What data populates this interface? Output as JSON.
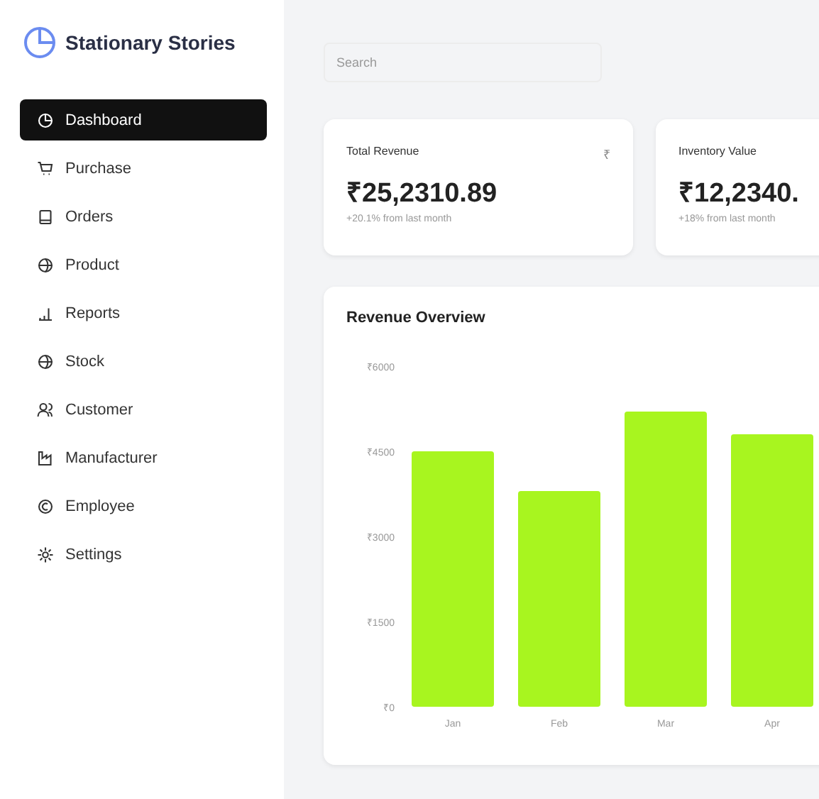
{
  "brand": {
    "name": "Stationary Stories"
  },
  "sidebar": {
    "items": [
      {
        "label": "Dashboard",
        "selected": true
      },
      {
        "label": "Purchase",
        "selected": false
      },
      {
        "label": "Orders",
        "selected": false
      },
      {
        "label": "Product",
        "selected": false
      },
      {
        "label": "Reports",
        "selected": false
      },
      {
        "label": "Stock",
        "selected": false
      },
      {
        "label": "Customer",
        "selected": false
      },
      {
        "label": "Manufacturer",
        "selected": false
      },
      {
        "label": "Employee",
        "selected": false
      },
      {
        "label": "Settings",
        "selected": false
      }
    ]
  },
  "search": {
    "placeholder": "Search"
  },
  "stats": [
    {
      "title": "Total Revenue",
      "value": "₹25,2310.89",
      "change": "+20.1% from last month",
      "symbol": "₹"
    },
    {
      "title": "Inventory Value",
      "value": "₹12,2340.",
      "change": "+18% from last month"
    }
  ],
  "revenue_overview": {
    "title": "Revenue Overview",
    "chart_data": {
      "type": "bar",
      "categories": [
        "Jan",
        "Feb",
        "Mar",
        "Apr"
      ],
      "series": [
        {
          "color": "#a8f51f",
          "values": [
            4500,
            3800,
            5200,
            4800
          ]
        }
      ],
      "ylim": [
        0,
        6000
      ],
      "yticks": [
        {
          "value": 0,
          "label": "₹0"
        },
        {
          "value": 1500,
          "label": "₹1500"
        },
        {
          "value": 3000,
          "label": "₹3000"
        },
        {
          "value": 4500,
          "label": "₹4500"
        },
        {
          "value": 6000,
          "label": "₹6000"
        }
      ]
    }
  }
}
